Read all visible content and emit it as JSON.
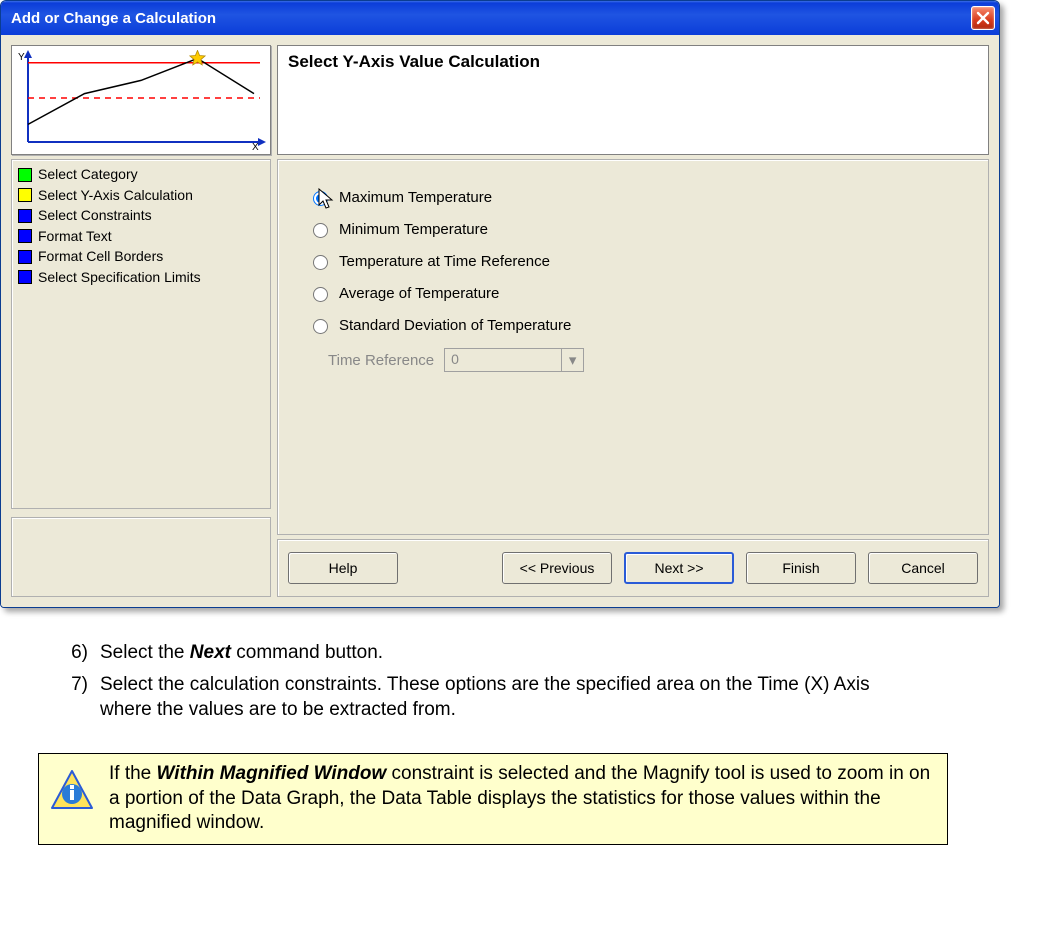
{
  "dialog": {
    "title": "Add or Change a Calculation",
    "heading": "Select Y-Axis Value Calculation",
    "steps": [
      {
        "label": "Select Category",
        "color": "#00ff00"
      },
      {
        "label": "Select Y-Axis Calculation",
        "color": "#ffff00"
      },
      {
        "label": "Select Constraints",
        "color": "#0000ff"
      },
      {
        "label": "Format Text",
        "color": "#0000ff"
      },
      {
        "label": "Format Cell Borders",
        "color": "#0000ff"
      },
      {
        "label": "Select Specification Limits",
        "color": "#0000ff"
      }
    ],
    "options": [
      "Maximum Temperature",
      "Minimum Temperature",
      "Temperature at Time Reference",
      "Average of Temperature",
      "Standard Deviation of Temperature"
    ],
    "selectedOption": 0,
    "timeRef": {
      "label": "Time Reference",
      "value": "0"
    },
    "buttons": {
      "help": "Help",
      "previous": "<< Previous",
      "next": "Next >>",
      "finish": "Finish",
      "cancel": "Cancel"
    },
    "axes": {
      "y": "Y",
      "x": "X"
    }
  },
  "instructions": [
    {
      "num": "6)",
      "before": "Select the ",
      "bold": "Next",
      "after": " command button."
    },
    {
      "num": "7)",
      "before": "Select the calculation constraints. These options are the specified area on the Time (X) Axis where the values are to be extracted from.",
      "bold": "",
      "after": ""
    }
  ],
  "note": {
    "before": "If the ",
    "bold": "Within Magnified Window",
    "after": " constraint is selected and the Magnify tool is used to zoom in on a portion of the Data Graph, the Data Table displays the statistics for those values within the magnified window."
  },
  "chart_data": {
    "type": "line",
    "title": "",
    "xlabel": "X",
    "ylabel": "Y",
    "x": [
      0,
      1,
      2,
      3,
      4
    ],
    "values": [
      20,
      55,
      70,
      95,
      55
    ],
    "ylim": [
      0,
      100
    ],
    "threshold_upper": 90,
    "threshold_mid": 50,
    "peak_index": 3
  }
}
